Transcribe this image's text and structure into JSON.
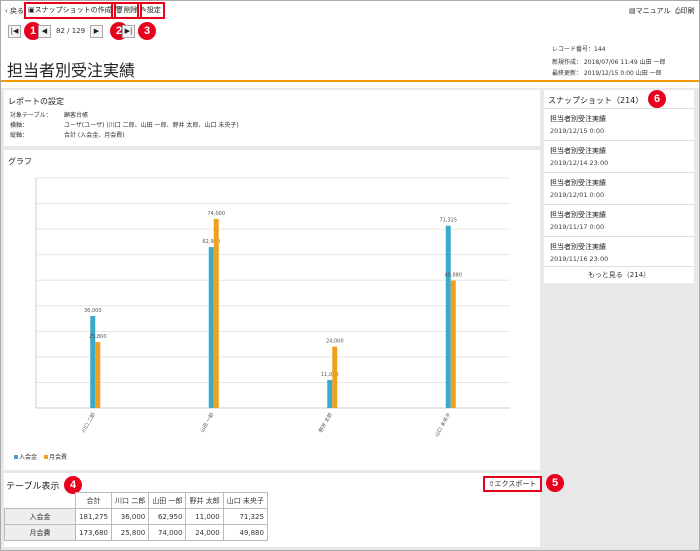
{
  "toolbar": {
    "back": "戻る",
    "create_snapshot": "スナップショットの作成",
    "delete": "削除",
    "settings": "設定",
    "manual": "マニュアル",
    "print": "印刷"
  },
  "badges": [
    "1",
    "2",
    "3",
    "4",
    "5",
    "6"
  ],
  "pager": {
    "text": "82 / 129"
  },
  "record": {
    "number_label": "レコード番号：144",
    "created": "新規作成： 2018/07/06 11:49 山田 一郎",
    "updated": "最終更新： 2019/12/15 0:00 山田 一郎"
  },
  "page_title": "担当者別受注実績",
  "report_settings": {
    "heading": "レポートの設定",
    "rows": [
      {
        "label": "対象テーブル：",
        "value": "顧客台帳"
      },
      {
        "label": "横軸：",
        "value": "ユーザ(ユーザ) (川口 二郎、山田 一郎、野井 太郎、山口 未央子)"
      },
      {
        "label": "縦軸：",
        "value": "合計 (入会金、月会費)"
      }
    ]
  },
  "graph": {
    "heading": "グラフ"
  },
  "chart_data": {
    "type": "bar",
    "categories": [
      "川口 二郎",
      "山田 一郎",
      "野井 太郎",
      "山口 未央子"
    ],
    "series": [
      {
        "name": "入会金",
        "values": [
          36000,
          62950,
          11000,
          71325
        ],
        "color": "#3ba9c9"
      },
      {
        "name": "月会費",
        "values": [
          25800,
          74000,
          24000,
          49880
        ],
        "color": "#f0a020"
      }
    ],
    "value_labels": [
      [
        "36,000",
        "62,950",
        "11,000",
        "71,325"
      ],
      [
        "25,800",
        "74,000",
        "24,000",
        "49,880"
      ]
    ],
    "ylim": [
      0,
      90000
    ],
    "grid": true,
    "legend": "bottom-left"
  },
  "table_section": {
    "heading": "テーブル表示",
    "export_label": "エクスポート",
    "columns": [
      "合計",
      "川口 二郎",
      "山田 一郎",
      "野井 太郎",
      "山口 未央子"
    ],
    "rows": [
      {
        "label": "入会金",
        "values": [
          "181,275",
          "36,000",
          "62,950",
          "11,000",
          "71,325"
        ]
      },
      {
        "label": "月会費",
        "values": [
          "173,680",
          "25,800",
          "74,000",
          "24,000",
          "49,880"
        ]
      }
    ]
  },
  "snapshots": {
    "heading": "スナップショット（214）",
    "items": [
      {
        "name": "担当者別受注実績",
        "date": "2019/12/15 0:00"
      },
      {
        "name": "担当者別受注実績",
        "date": "2019/12/14 23:00"
      },
      {
        "name": "担当者別受注実績",
        "date": "2019/12/01 0:00"
      },
      {
        "name": "担当者別受注実績",
        "date": "2019/11/17 0:00"
      },
      {
        "name": "担当者別受注実績",
        "date": "2019/11/16 23:00"
      }
    ],
    "more_label": "もっと見る（214）"
  },
  "colors": {
    "accent": "#f39800",
    "highlight": "#e8001c"
  }
}
